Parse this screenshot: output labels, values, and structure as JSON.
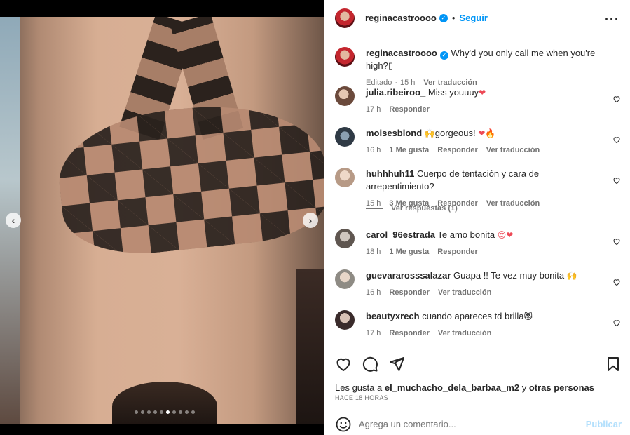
{
  "post": {
    "username": "reginacastroooo",
    "follow_label": "Seguir",
    "bullet": "•",
    "more_icon": "more-horizontal-icon",
    "caption": "Why'd you only call me when you're high?",
    "caption_glyph": "▯",
    "edited_label": "Editado",
    "caption_time": "15 h",
    "translate_label": "Ver traducción"
  },
  "comments": [
    {
      "user": "julia.ribeiroo_",
      "text": "Miss youuuy",
      "emoji": "❤",
      "time": "17 h",
      "likes": "",
      "reply": "Responder",
      "translate": ""
    },
    {
      "user": "moisesblond",
      "text": "gorgeous!",
      "emoji_pre": "🙌",
      "emoji": "❤🔥",
      "time": "16 h",
      "likes": "1 Me gusta",
      "reply": "Responder",
      "translate": "Ver traducción"
    },
    {
      "user": "huhhhuh11",
      "text": "Cuerpo de tentación y cara de arrepentimiento?",
      "emoji": "",
      "time": "15 h",
      "likes": "3 Me gusta",
      "reply": "Responder",
      "translate": "Ver traducción"
    },
    {
      "user": "carol_96estrada",
      "text": "Te amo bonita",
      "emoji": "😍❤",
      "time": "18 h",
      "likes": "1 Me gusta",
      "reply": "Responder",
      "translate": ""
    },
    {
      "user": "guevararosssalazar",
      "text": "Guapa !! Te vez muy bonita",
      "emoji": "🙌",
      "time": "16 h",
      "likes": "",
      "reply": "Responder",
      "translate": "Ver traducción"
    },
    {
      "user": "beautyxrech",
      "text": "cuando apareces td brilla",
      "emoji": "😻",
      "time": "17 h",
      "likes": "",
      "reply": "Responder",
      "translate": "Ver traducción"
    }
  ],
  "view_replies": "Ver respuestas (1)",
  "likes": {
    "prefix": "Les gusta a",
    "user": "el_muchacho_dela_barbaa_m2",
    "conj": "y",
    "others": "otras personas"
  },
  "timestamp": "HACE 18 HORAS",
  "comment_box": {
    "placeholder": "Agrega un comentario...",
    "publish": "Publicar"
  },
  "carousel": {
    "prev": "‹",
    "next": "›",
    "dot_count": 10,
    "active_index": 5
  },
  "colors": {
    "accent": "#0095f6",
    "like_red": "#ed4956",
    "publish_disabled": "#b2dffc"
  }
}
